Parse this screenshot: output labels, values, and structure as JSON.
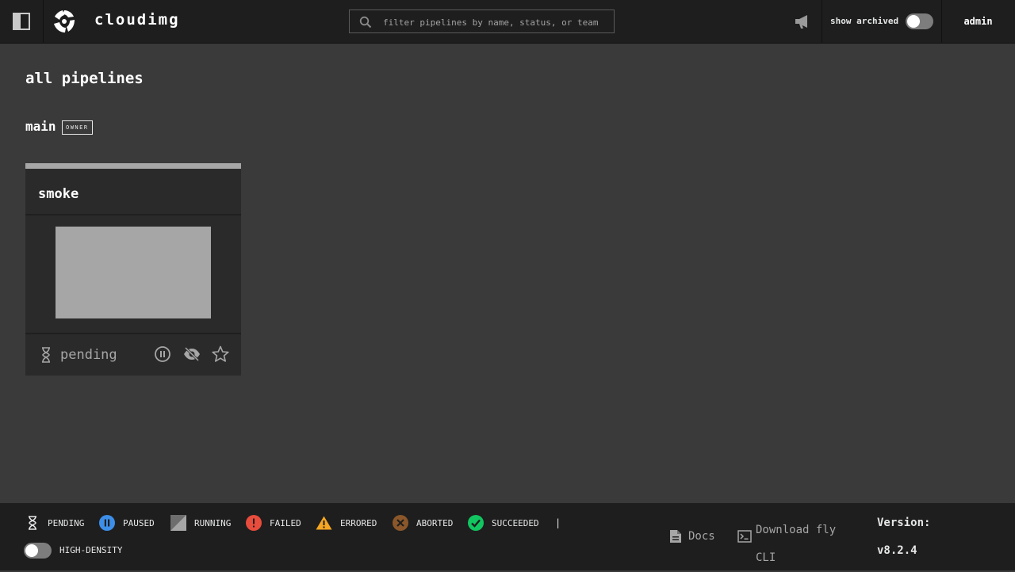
{
  "app": {
    "title": "cloudimg"
  },
  "search": {
    "placeholder": "filter pipelines by name, status, or team"
  },
  "header": {
    "show_archived_label": "show archived",
    "user": "admin"
  },
  "main": {
    "title": "all pipelines",
    "team": {
      "name": "main",
      "badge": "OWNER"
    },
    "pipelines": [
      {
        "name": "smoke",
        "status": "pending"
      }
    ]
  },
  "legend": {
    "items": [
      {
        "label": "PENDING",
        "icon": "hourglass-icon"
      },
      {
        "label": "PAUSED",
        "icon": "pause-circle-icon",
        "color": "#3d8ee8"
      },
      {
        "label": "RUNNING",
        "icon": "running-icon"
      },
      {
        "label": "FAILED",
        "icon": "exclamation-circle-icon",
        "color": "#e74c3c"
      },
      {
        "label": "ERRORED",
        "icon": "warning-triangle-icon",
        "color": "#f5a623"
      },
      {
        "label": "ABORTED",
        "icon": "x-circle-icon",
        "color": "#8b572a"
      },
      {
        "label": "SUCCEEDED",
        "icon": "check-circle-icon",
        "color": "#11c560"
      }
    ],
    "separator": "|",
    "high_density_label": "HIGH-DENSITY"
  },
  "footer": {
    "docs_label": "Docs",
    "fly_label": "Download fly CLI",
    "version_label": "Version:",
    "version_value": "v8.2.4"
  }
}
